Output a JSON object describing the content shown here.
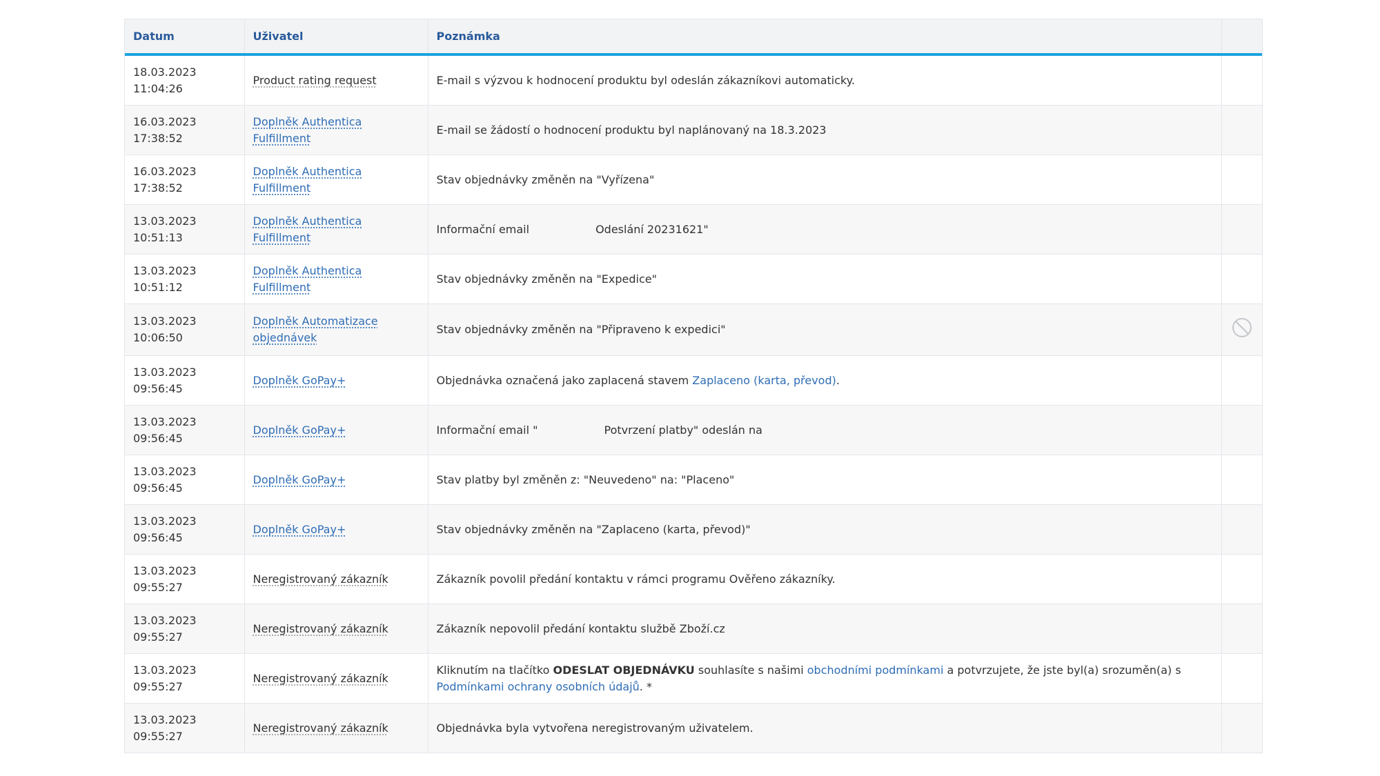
{
  "table": {
    "headers": {
      "date": "Datum",
      "user": "Uživatel",
      "note": "Poznámka"
    },
    "rows": [
      {
        "date": "18.03.2023",
        "time": "11:04:26",
        "user": "Product rating request",
        "note": "E-mail s výzvou k hodnocení produktu byl odeslán zákazníkovi automaticky."
      },
      {
        "date": "16.03.2023",
        "time": "17:38:52",
        "user": "Doplněk Authentica Fulfillment",
        "note": "E-mail se žádostí o hodnocení produktu byl naplánovaný na 18.3.2023"
      },
      {
        "date": "16.03.2023",
        "time": "17:38:52",
        "user": "Doplněk Authentica Fulfillment",
        "note": "Stav objednávky změněn na \"Vyřízena\""
      },
      {
        "date": "13.03.2023",
        "time": "10:51:13",
        "user": "Doplněk Authentica Fulfillment",
        "note_a": "Informační email",
        "note_b": "Odeslání 20231621\""
      },
      {
        "date": "13.03.2023",
        "time": "10:51:12",
        "user": "Doplněk Authentica Fulfillment",
        "note": "Stav objednávky změněn na \"Expedice\""
      },
      {
        "date": "13.03.2023",
        "time": "10:06:50",
        "user": "Doplněk Automatizace objednávek",
        "note": "Stav objednávky změněn na \"Připraveno k expedici\""
      },
      {
        "date": "13.03.2023",
        "time": "09:56:45",
        "user": "Doplněk GoPay+",
        "note_a": "Objednávka označená jako zaplacená stavem ",
        "note_link": "Zaplaceno (karta, převod)",
        "note_b": "."
      },
      {
        "date": "13.03.2023",
        "time": "09:56:45",
        "user": "Doplněk GoPay+",
        "note_a": "Informační email \"",
        "note_b": "Potvrzení platby\" odeslán na"
      },
      {
        "date": "13.03.2023",
        "time": "09:56:45",
        "user": "Doplněk GoPay+",
        "note": "Stav platby byl změněn z: \"Neuvedeno\" na: \"Placeno\""
      },
      {
        "date": "13.03.2023",
        "time": "09:56:45",
        "user": "Doplněk GoPay+",
        "note": "Stav objednávky změněn na \"Zaplaceno (karta, převod)\""
      },
      {
        "date": "13.03.2023",
        "time": "09:55:27",
        "user": "Neregistrovaný zákazník",
        "note": "Zákazník povolil předání kontaktu v rámci programu Ověřeno zákazníky."
      },
      {
        "date": "13.03.2023",
        "time": "09:55:27",
        "user": "Neregistrovaný zákazník",
        "note": "Zákazník nepovolil předání kontaktu službě Zboží.cz"
      },
      {
        "date": "13.03.2023",
        "time": "09:55:27",
        "user": "Neregistrovaný zákazník",
        "note_a": "Kliknutím na tlačítko ",
        "note_bold": "ODESLAT OBJEDNÁVKU",
        "note_b": " souhlasíte s našimi ",
        "note_link1": "obchodními podmínkami",
        "note_c": " a potvrzujete, že jste byl(a) srozuměn(a) s ",
        "note_link2": "Podmínkami ochrany osobních údajů",
        "note_d": ". *"
      },
      {
        "date": "13.03.2023",
        "time": "09:55:27",
        "user": "Neregistrovaný zákazník",
        "note": "Objednávka byla vytvořena neregistrovaným uživatelem."
      }
    ],
    "actions": {
      "row6_icon": "ban-icon"
    }
  },
  "colors": {
    "header_text": "#2a5b9c",
    "header_rule": "#1aa2e0",
    "link": "#2f6db5"
  }
}
